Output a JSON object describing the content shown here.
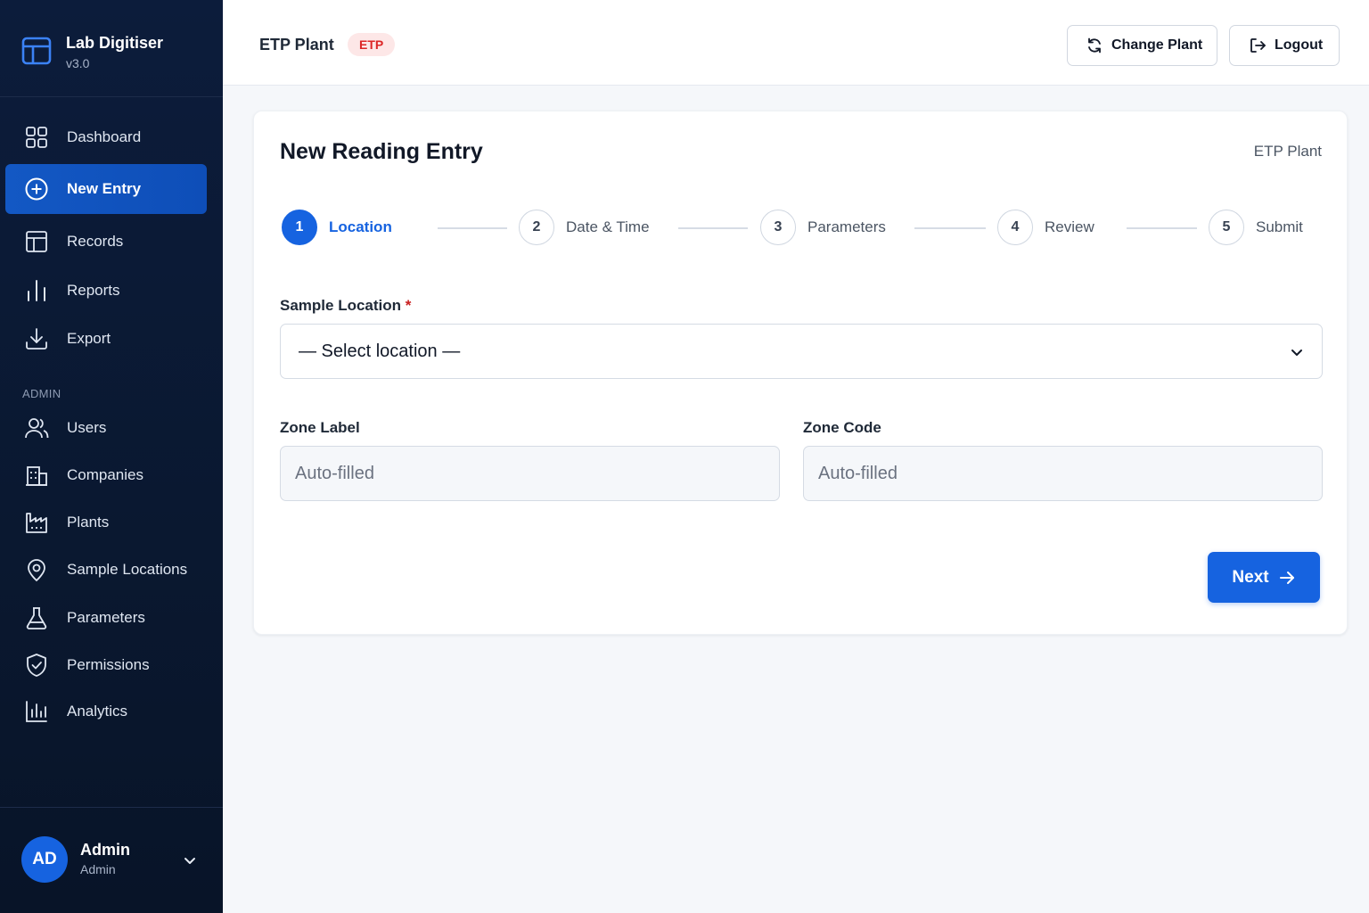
{
  "brand": {
    "name": "Lab Digitiser",
    "version": "v3.0"
  },
  "nav": {
    "items": [
      {
        "label": "Dashboard",
        "icon": "dashboard-grid-icon"
      },
      {
        "label": "New Entry",
        "icon": "plus-circle-icon",
        "active": true
      },
      {
        "label": "Records",
        "icon": "records-table-icon"
      },
      {
        "label": "Reports",
        "icon": "bar-chart-icon"
      },
      {
        "label": "Export",
        "icon": "download-icon"
      }
    ],
    "admin_heading": "ADMIN",
    "admin_items": [
      {
        "label": "Users",
        "icon": "users-icon"
      },
      {
        "label": "Companies",
        "icon": "building-icon"
      },
      {
        "label": "Plants",
        "icon": "factory-icon"
      },
      {
        "label": "Sample Locations",
        "icon": "map-pin-icon"
      },
      {
        "label": "Parameters",
        "icon": "flask-icon"
      },
      {
        "label": "Permissions",
        "icon": "shield-check-icon"
      },
      {
        "label": "Analytics",
        "icon": "analytics-chart-icon"
      }
    ]
  },
  "user": {
    "initials": "AD",
    "name": "Admin",
    "role": "Admin"
  },
  "topbar": {
    "plant": "ETP Plant",
    "badge": "ETP",
    "change_plant": "Change Plant",
    "logout": "Logout"
  },
  "card": {
    "title": "New Reading Entry",
    "plant": "ETP Plant"
  },
  "steps": [
    {
      "num": "1",
      "label": "Location",
      "active": true
    },
    {
      "num": "2",
      "label": "Date & Time"
    },
    {
      "num": "3",
      "label": "Parameters"
    },
    {
      "num": "4",
      "label": "Review"
    },
    {
      "num": "5",
      "label": "Submit"
    }
  ],
  "form": {
    "sample_location_label": "Sample Location",
    "required_mark": "*",
    "sample_location_value": "— Select location —",
    "zone_label_label": "Zone Label",
    "zone_label_placeholder": "Auto-filled",
    "zone_code_label": "Zone Code",
    "zone_code_placeholder": "Auto-filled",
    "next_label": "Next"
  },
  "colors": {
    "sidebar_bg": "#0c1c3b",
    "accent": "#1663e0",
    "badge_bg": "#fde7e7",
    "badge_text": "#dc2626"
  }
}
